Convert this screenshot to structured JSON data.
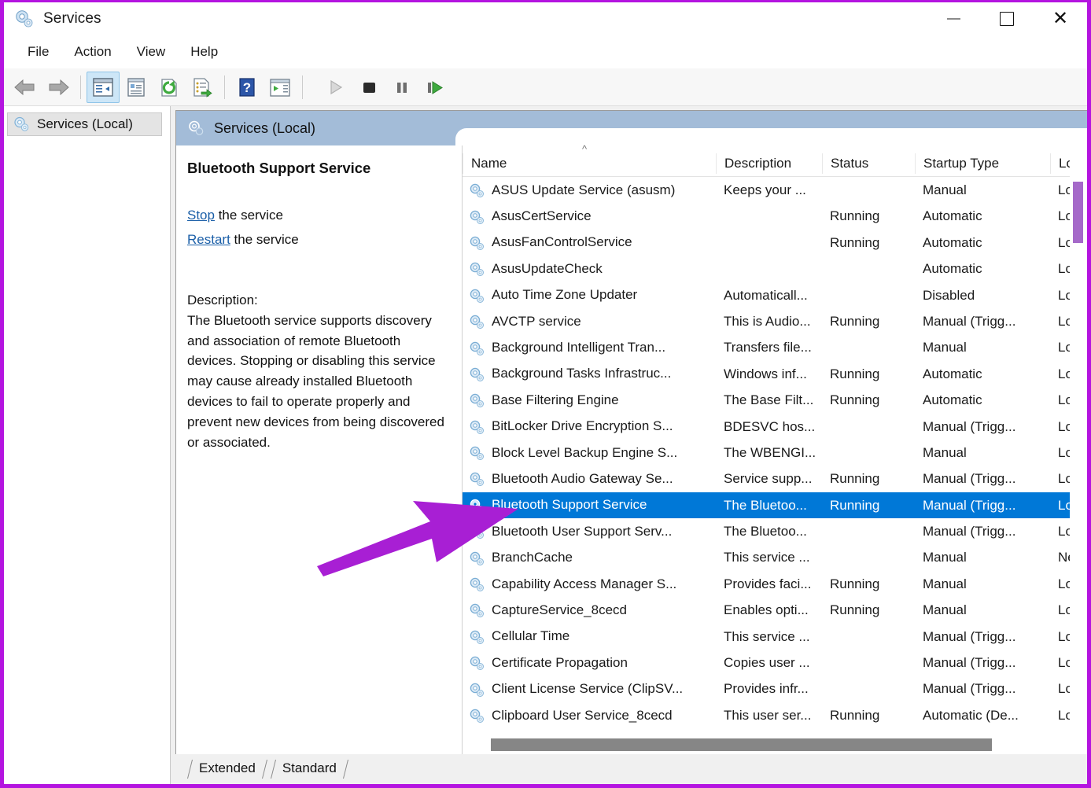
{
  "window": {
    "title": "Services",
    "app_icon": "gear-icon",
    "controls": {
      "minimize": "minimize-icon",
      "maximize": "maximize-icon",
      "close": "close-icon"
    }
  },
  "menubar": {
    "items": [
      {
        "label": "File"
      },
      {
        "label": "Action"
      },
      {
        "label": "View"
      },
      {
        "label": "Help"
      }
    ]
  },
  "toolbar": {
    "buttons": [
      {
        "name": "back-button",
        "icon": "back-arrow-icon",
        "enabled": false
      },
      {
        "name": "forward-button",
        "icon": "forward-arrow-icon",
        "enabled": false
      },
      {
        "name": "show-hide-console-tree-button",
        "icon": "console-tree-icon",
        "pressed": true
      },
      {
        "name": "properties-button",
        "icon": "properties-icon"
      },
      {
        "name": "refresh-button",
        "icon": "refresh-icon"
      },
      {
        "name": "export-list-button",
        "icon": "export-list-icon"
      },
      {
        "name": "help-button",
        "icon": "help-question-icon"
      },
      {
        "name": "show-action-pane-button",
        "icon": "action-pane-icon"
      },
      {
        "name": "start-service-button",
        "icon": "play-icon",
        "enabled": false
      },
      {
        "name": "stop-service-button",
        "icon": "stop-icon"
      },
      {
        "name": "pause-service-button",
        "icon": "pause-icon"
      },
      {
        "name": "restart-service-button",
        "icon": "restart-icon"
      }
    ]
  },
  "sidebar": {
    "items": [
      {
        "label": "Services (Local)",
        "icon": "gear-icon",
        "selected": true
      }
    ]
  },
  "pane": {
    "header_title": "Services (Local)",
    "header_icon": "gear-icon"
  },
  "details": {
    "service_name": "Bluetooth Support Service",
    "actions": [
      {
        "link": "Stop",
        "suffix": " the service"
      },
      {
        "link": "Restart",
        "suffix": " the service"
      }
    ],
    "description_label": "Description:",
    "description_text": "The Bluetooth service supports discovery and association of remote Bluetooth devices.  Stopping or disabling this service may cause already installed Bluetooth devices to fail to operate properly and prevent new devices from being discovered or associated."
  },
  "list": {
    "sort_indicator": "ascending-sort-icon",
    "columns": [
      {
        "key": "name",
        "label": "Name"
      },
      {
        "key": "description",
        "label": "Description"
      },
      {
        "key": "status",
        "label": "Status"
      },
      {
        "key": "startup",
        "label": "Startup Type"
      },
      {
        "key": "logon",
        "label": "Log"
      }
    ],
    "rows": [
      {
        "name": "ASUS Update Service (asusm)",
        "description": "Keeps your ...",
        "status": "",
        "startup": "Manual",
        "logon": "Loc",
        "selected": false
      },
      {
        "name": "AsusCertService",
        "description": "",
        "status": "Running",
        "startup": "Automatic",
        "logon": "Loc",
        "selected": false
      },
      {
        "name": "AsusFanControlService",
        "description": "",
        "status": "Running",
        "startup": "Automatic",
        "logon": "Loc",
        "selected": false
      },
      {
        "name": "AsusUpdateCheck",
        "description": "",
        "status": "",
        "startup": "Automatic",
        "logon": "Loc",
        "selected": false
      },
      {
        "name": "Auto Time Zone Updater",
        "description": "Automaticall...",
        "status": "",
        "startup": "Disabled",
        "logon": "Loc",
        "selected": false
      },
      {
        "name": "AVCTP service",
        "description": "This is Audio...",
        "status": "Running",
        "startup": "Manual (Trigg...",
        "logon": "Loc",
        "selected": false
      },
      {
        "name": "Background Intelligent Tran...",
        "description": "Transfers file...",
        "status": "",
        "startup": "Manual",
        "logon": "Loc",
        "selected": false
      },
      {
        "name": "Background Tasks Infrastruc...",
        "description": "Windows inf...",
        "status": "Running",
        "startup": "Automatic",
        "logon": "Loc",
        "selected": false
      },
      {
        "name": "Base Filtering Engine",
        "description": "The Base Filt...",
        "status": "Running",
        "startup": "Automatic",
        "logon": "Loc",
        "selected": false
      },
      {
        "name": "BitLocker Drive Encryption S...",
        "description": "BDESVC hos...",
        "status": "",
        "startup": "Manual (Trigg...",
        "logon": "Loc",
        "selected": false
      },
      {
        "name": "Block Level Backup Engine S...",
        "description": "The WBENGI...",
        "status": "",
        "startup": "Manual",
        "logon": "Loc",
        "selected": false
      },
      {
        "name": "Bluetooth Audio Gateway Se...",
        "description": "Service supp...",
        "status": "Running",
        "startup": "Manual (Trigg...",
        "logon": "Loc",
        "selected": false
      },
      {
        "name": "Bluetooth Support Service",
        "description": "The Bluetoo...",
        "status": "Running",
        "startup": "Manual (Trigg...",
        "logon": "Loc",
        "selected": true
      },
      {
        "name": "Bluetooth User Support Serv...",
        "description": "The Bluetoo...",
        "status": "",
        "startup": "Manual (Trigg...",
        "logon": "Loc",
        "selected": false
      },
      {
        "name": "BranchCache",
        "description": "This service ...",
        "status": "",
        "startup": "Manual",
        "logon": "Ne",
        "selected": false
      },
      {
        "name": "Capability Access Manager S...",
        "description": "Provides faci...",
        "status": "Running",
        "startup": "Manual",
        "logon": "Loc",
        "selected": false
      },
      {
        "name": "CaptureService_8cecd",
        "description": "Enables opti...",
        "status": "Running",
        "startup": "Manual",
        "logon": "Loc",
        "selected": false
      },
      {
        "name": "Cellular Time",
        "description": "This service ...",
        "status": "",
        "startup": "Manual (Trigg...",
        "logon": "Loc",
        "selected": false
      },
      {
        "name": "Certificate Propagation",
        "description": "Copies user ...",
        "status": "",
        "startup": "Manual (Trigg...",
        "logon": "Loc",
        "selected": false
      },
      {
        "name": "Client License Service (ClipSV...",
        "description": "Provides infr...",
        "status": "",
        "startup": "Manual (Trigg...",
        "logon": "Loc",
        "selected": false
      },
      {
        "name": "Clipboard User Service_8cecd",
        "description": "This user ser...",
        "status": "Running",
        "startup": "Automatic (De...",
        "logon": "Loc",
        "selected": false
      }
    ]
  },
  "tabs": [
    {
      "label": "Extended",
      "active": false
    },
    {
      "label": "Standard",
      "active": false
    }
  ],
  "annotation": {
    "arrow_color": "#a81fd4",
    "points_to": "Bluetooth Support Service"
  },
  "colors": {
    "selection_blue": "#0078d7",
    "pane_header_blue": "#a3bcd8",
    "accent_purple": "#b414e0",
    "link_blue": "#1b5fa8"
  }
}
